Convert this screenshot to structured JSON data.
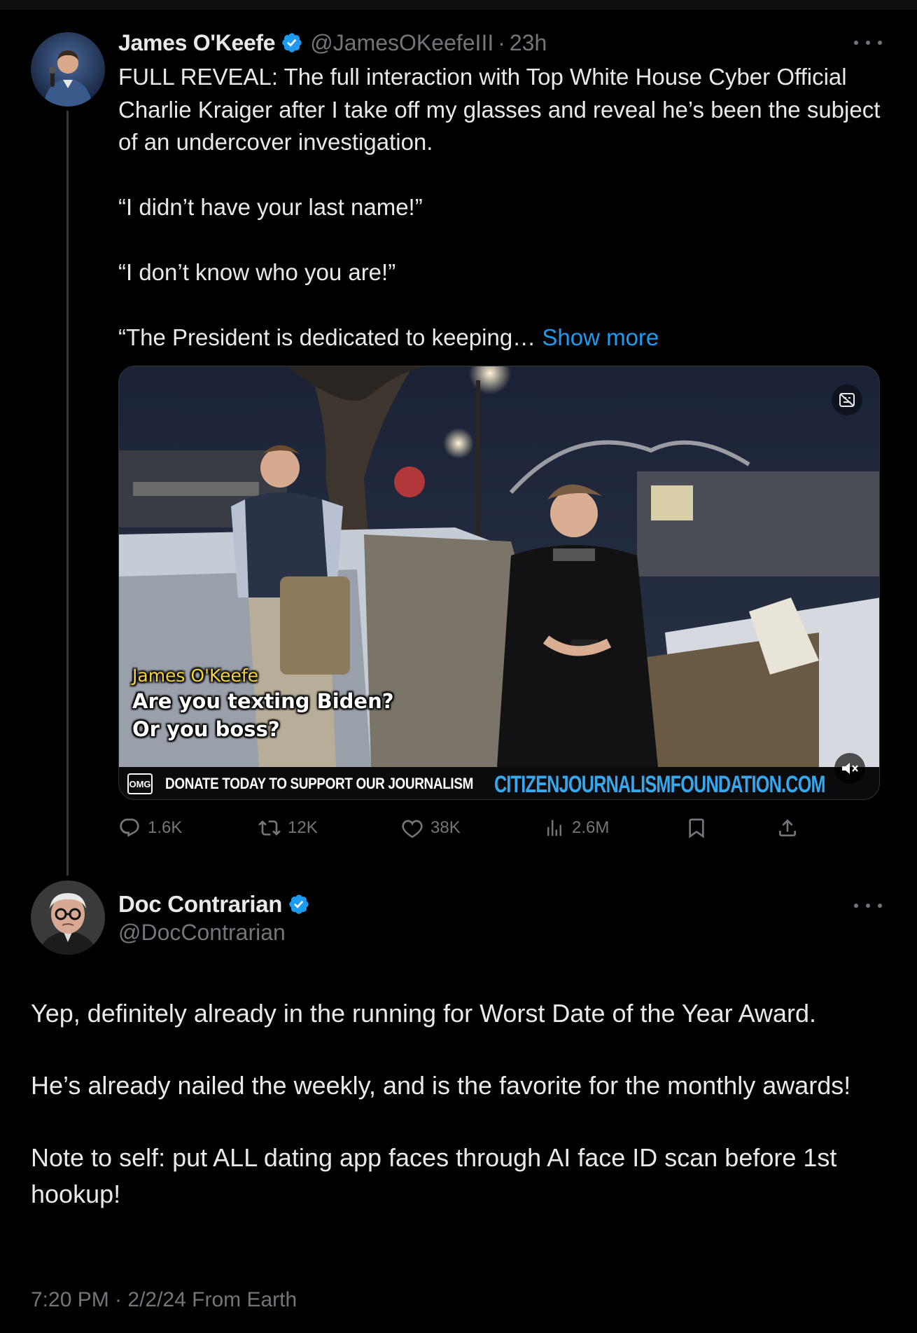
{
  "quoted_tweet": {
    "author_name": "James O'Keefe",
    "handle": "@JamesOKeefeIII",
    "time": "23h",
    "separator": "·",
    "text_lines": [
      "FULL REVEAL: The full interaction with Top White House Cyber Official Charlie Kraiger after I take off my glasses and reveal he’s been the subject of an undercover investigation.",
      "“I didn’t have your last name!”",
      "“I don’t know who you are!”",
      "“The President is dedicated to keeping…"
    ],
    "show_more_label": "Show more",
    "video": {
      "caption_speaker": "James O'Keefe",
      "caption_line_1": "Are you texting Biden?",
      "caption_line_2": "Or you boss?",
      "banner_logo": "OMG",
      "banner_text": "DONATE TODAY TO SUPPORT OUR JOURNALISM",
      "banner_site": "CITIZENJOURNALISMFOUNDATION.COM"
    },
    "stats": {
      "replies": "1.6K",
      "reposts": "12K",
      "likes": "38K",
      "views": "2.6M"
    }
  },
  "main_tweet": {
    "author_name": "Doc Contrarian",
    "handle": "@DocContrarian",
    "paragraphs": [
      "Yep, definitely already in the running for Worst Date of the Year Award.",
      "He’s already nailed the weekly, and is the favorite for the monthly awards!",
      "Note to self: put ALL dating app faces through AI face ID scan before 1st hookup!"
    ],
    "meta": "7:20 PM · 2/2/24 From Earth"
  },
  "colors": {
    "background": "#000000",
    "text": "#e7e9ea",
    "muted": "#71767b",
    "accent": "#1d9bf0",
    "banner_site": "#35a8ee",
    "caption_speaker": "#f5d33c"
  },
  "icons": {
    "verified": "verified-badge-icon",
    "more": "more-horizontal-icon",
    "reply": "reply-icon",
    "repost": "repost-icon",
    "like": "heart-icon",
    "views": "views-chart-icon",
    "bookmark": "bookmark-icon",
    "share": "share-icon",
    "mute": "mute-icon",
    "captions": "captions-icon"
  }
}
